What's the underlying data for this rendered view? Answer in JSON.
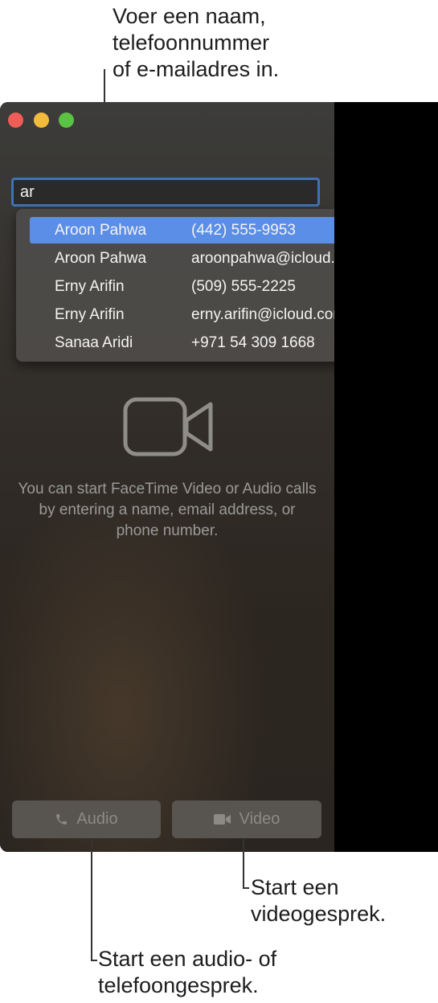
{
  "callouts": {
    "search_hint": [
      "Voer een naam,",
      "telefoonnummer",
      "of e-mailadres in."
    ],
    "video_hint": [
      "Start een",
      "videogesprek."
    ],
    "audio_hint": [
      "Start een audio- of",
      "telefoongesprek."
    ]
  },
  "search": {
    "value": "ar"
  },
  "suggestions": [
    {
      "name": "Aroon Pahwa",
      "detail": "(442) 555-9953",
      "selected": true
    },
    {
      "name": "Aroon Pahwa",
      "detail": "aroonpahwa@icloud.com",
      "selected": false
    },
    {
      "name": "Erny Arifin",
      "detail": "(509) 555-2225",
      "selected": false
    },
    {
      "name": "Erny Arifin",
      "detail": "erny.arifin@icloud.com",
      "selected": false
    },
    {
      "name": "Sanaa Aridi",
      "detail": "+971 54 309 1668",
      "selected": false
    }
  ],
  "empty_state": {
    "icon": "video-camera-icon",
    "message": "You can start FaceTime Video or Audio calls by entering a name, email address, or phone number."
  },
  "buttons": {
    "audio_label": "Audio",
    "audio_icon": "phone-icon",
    "video_label": "Video",
    "video_icon": "video-camera-icon"
  },
  "colors": {
    "selection": "#5b8ee6",
    "focus_ring": "#3f73b3",
    "close": "#ee5d57",
    "minimize": "#f2bb3b",
    "zoom": "#5cc244"
  }
}
